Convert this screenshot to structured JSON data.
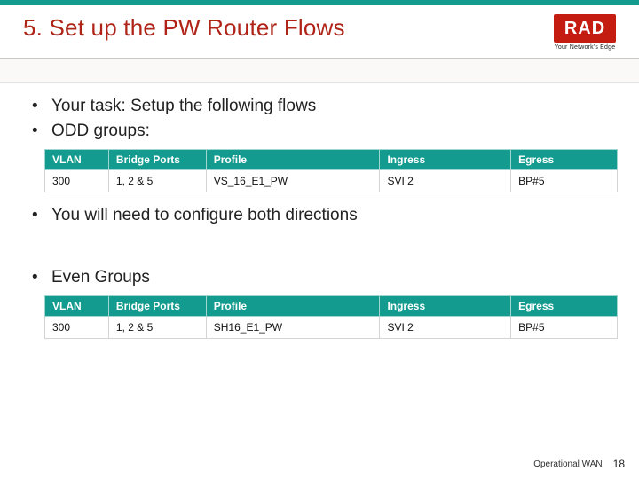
{
  "header": {
    "title": "5. Set up the PW Router Flows",
    "logo_text": "RAD",
    "logo_tagline": "Your Network's Edge"
  },
  "bullets_top": [
    "Your task: Setup the following flows",
    "ODD groups:"
  ],
  "table_headers": [
    "VLAN",
    "Bridge Ports",
    "Profile",
    "Ingress",
    "Egress"
  ],
  "table_odd": {
    "rows": [
      {
        "vlan": "300",
        "bridge_ports": "1, 2 & 5",
        "profile": "VS_16_E1_PW",
        "ingress": "SVI 2",
        "egress": "BP#5"
      }
    ]
  },
  "bullets_mid": [
    "You will need to configure both directions"
  ],
  "bullets_low": [
    "Even Groups"
  ],
  "table_even": {
    "rows": [
      {
        "vlan": "300",
        "bridge_ports": "1, 2 & 5",
        "profile": "SH16_E1_PW",
        "ingress": "SVI 2",
        "egress": "BP#5"
      }
    ]
  },
  "footer": {
    "label": "Operational WAN",
    "page": "18"
  }
}
